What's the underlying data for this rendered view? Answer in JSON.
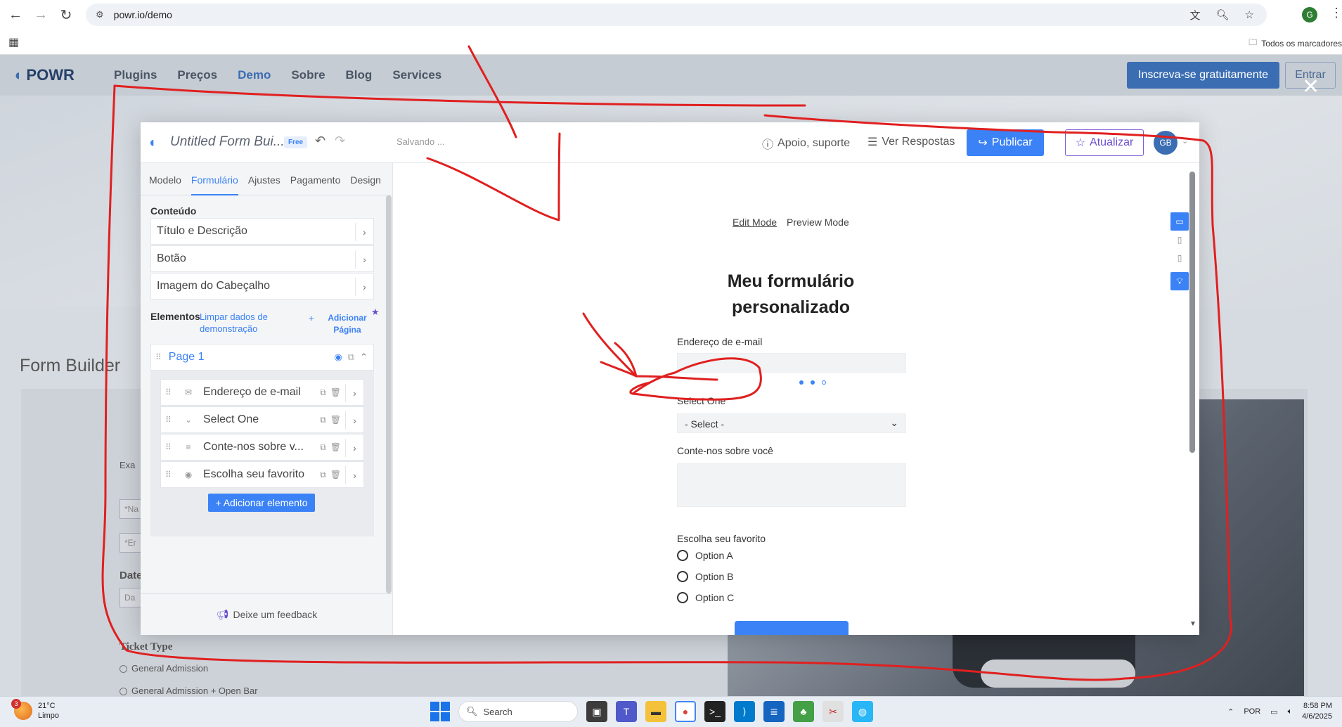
{
  "browser": {
    "url": "powr.io/demo",
    "bookmarks_label": "Todos os marcadores",
    "profile_initial": "G"
  },
  "site": {
    "logo": "POWR",
    "menu": [
      "Plugins",
      "Preços",
      "Demo",
      "Sobre",
      "Blog",
      "Services"
    ],
    "active_menu": "Demo",
    "signup_label": "Inscreva-se gratuitamente",
    "login_label": "Entrar",
    "heading": "Form Builder",
    "left_labels": {
      "exam": "Exa",
      "name_ph": "*Na",
      "email_ph": "*Er",
      "date_label": "Date",
      "date_ph": "Da",
      "ticket_type": "Ticket Type",
      "ticket_opt1": "General Admission",
      "ticket_opt2": "General Admission + Open Bar"
    }
  },
  "editor": {
    "form_name": "Untitled Form Bui...",
    "plan_badge": "Free",
    "saving_text": "Salvando ...",
    "help_label": "Apoio, suporte",
    "responses_label": "Ver Respostas",
    "publish_label": "Publicar",
    "upgrade_label": "Atualizar",
    "avatar_initials": "GB",
    "tabs": [
      "Modelo",
      "Formulário",
      "Ajustes",
      "Pagamento",
      "Design"
    ],
    "active_tab": "Formulário",
    "content_section": "Conteúdo",
    "content_items": [
      "Título e Descrição",
      "Botão",
      "Imagem do Cabeçalho"
    ],
    "elements_label": "Elementos",
    "clear_demo_link": "Limpar dados de demonstração",
    "add_page_label": "Adicionar Página",
    "page_title": "Page 1",
    "elements": [
      {
        "label": "Endereço de e-mail",
        "icon": "mail-icon"
      },
      {
        "label": "Select One",
        "icon": "chevron-down-icon"
      },
      {
        "label": "Conte-nos sobre v...",
        "icon": "paragraph-icon"
      },
      {
        "label": "Escolha seu favorito",
        "icon": "radio-icon"
      }
    ],
    "add_element_label": "+ Adicionar elemento",
    "feedback_label": "Deixe um feedback"
  },
  "preview": {
    "edit_mode": "Edit Mode",
    "preview_mode": "Preview Mode",
    "form_title_line1": "Meu formulário",
    "form_title_line2": "personalizado",
    "email_label": "Endereço de e-mail",
    "select_label": "Select One",
    "select_value": "- Select -",
    "about_label": "Conte-nos sobre você",
    "favorite_label": "Escolha seu favorito",
    "options": [
      "Option A",
      "Option B",
      "Option C"
    ]
  },
  "taskbar": {
    "weather_temp": "21°C",
    "weather_desc": "Limpo",
    "weather_badge": "3",
    "search_label": "Search",
    "lang": "POR",
    "time": "8:58 PM",
    "date": "4/6/2025"
  },
  "annotation_color": "#e02020",
  "accent_color": "#3b82f6"
}
